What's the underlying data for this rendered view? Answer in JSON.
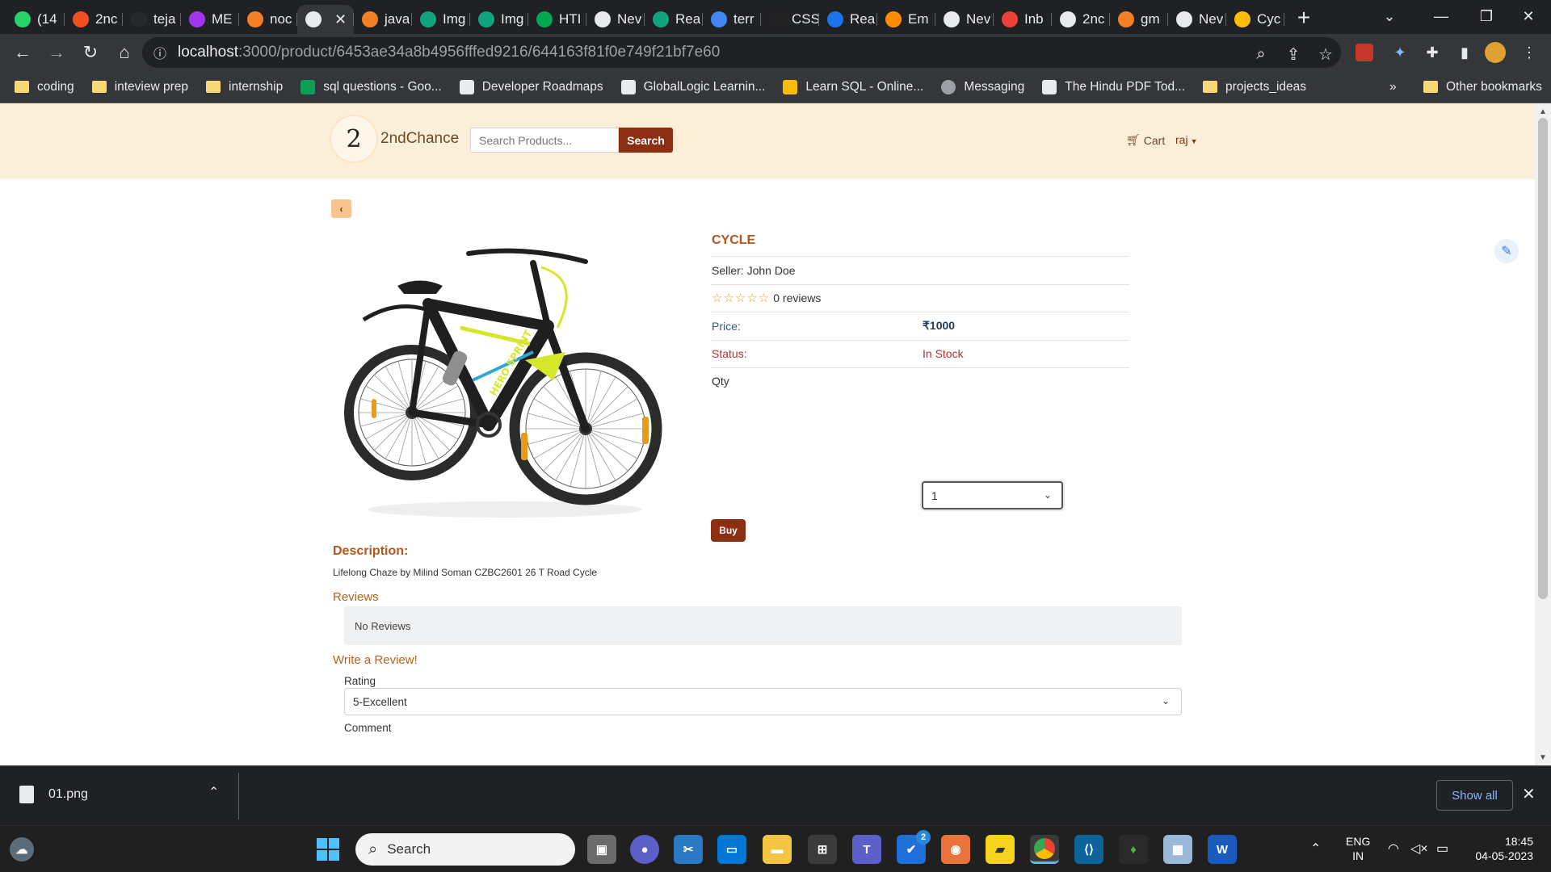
{
  "browser": {
    "tabs": [
      {
        "label": "(14",
        "color": "#25d366"
      },
      {
        "label": "2nc",
        "color": "#f24e1e"
      },
      {
        "label": "teja",
        "color": "#24292e"
      },
      {
        "label": "ME",
        "color": "#a435f0"
      },
      {
        "label": "noc",
        "color": "#f48024"
      },
      {
        "label": "",
        "color": "#e8eaed",
        "active": true
      },
      {
        "label": "java",
        "color": "#f48024"
      },
      {
        "label": "Img",
        "color": "#10a37f"
      },
      {
        "label": "Img",
        "color": "#10a37f"
      },
      {
        "label": "HTI",
        "color": "#00a651"
      },
      {
        "label": "Nev",
        "color": "#e8eaed"
      },
      {
        "label": "Rea",
        "color": "#10a37f"
      },
      {
        "label": "terr",
        "color": "#4285f4"
      },
      {
        "label": "CSS",
        "color": "#222222"
      },
      {
        "label": "Rea",
        "color": "#1a73e8"
      },
      {
        "label": "Em",
        "color": "#ff8c00"
      },
      {
        "label": "Nev",
        "color": "#e8eaed"
      },
      {
        "label": "Inb",
        "color": "#ea4335"
      },
      {
        "label": "2nc",
        "color": "#e8eaed"
      },
      {
        "label": "gm",
        "color": "#f48024"
      },
      {
        "label": "Nev",
        "color": "#e8eaed"
      },
      {
        "label": "Cyc",
        "color": "#fbbc04"
      }
    ],
    "url_host": "localhost",
    "url_path": ":3000/product/6453ae34a8b4956fffed9216/644163f81f0e749f21bf7e60",
    "bookmarks": [
      {
        "label": "coding",
        "type": "folder"
      },
      {
        "label": "inteview prep",
        "type": "folder"
      },
      {
        "label": "internship",
        "type": "folder"
      },
      {
        "label": "sql questions - Goo...",
        "type": "sheet"
      },
      {
        "label": "Developer Roadmaps",
        "type": "site"
      },
      {
        "label": "GlobalLogic Learnin...",
        "type": "site"
      },
      {
        "label": "Learn SQL - Online...",
        "type": "key"
      },
      {
        "label": "Messaging",
        "type": "globe"
      },
      {
        "label": "The Hindu PDF Tod...",
        "type": "site"
      },
      {
        "label": "projects_ideas",
        "type": "folder"
      }
    ],
    "bookmarks_more": "»",
    "other_bookmarks": "Other bookmarks"
  },
  "site": {
    "logo_text": "2",
    "brand": "2ndChance",
    "search_placeholder": "Search Products...",
    "search_button": "Search",
    "cart_label": "Cart",
    "user_label": "raj"
  },
  "product": {
    "back_symbol": "‹",
    "title": "CYCLE",
    "seller": "Seller: John Doe",
    "rating_stars": 0,
    "reviews_text": "0 reviews",
    "price_label": "Price:",
    "price_value": "₹1000",
    "status_label": "Status:",
    "status_value": "In Stock",
    "qty_label": "Qty",
    "qty_value": "1",
    "buy_label": "Buy",
    "description_heading": "Description:",
    "description_text": "Lifelong Chaze by Milind Soman CZBC2601 26 T Road Cycle",
    "reviews_heading": "Reviews",
    "no_reviews": "No Reviews",
    "write_review_heading": "Write a Review!",
    "rating_label": "Rating",
    "rating_value": "5-Excellent",
    "comment_label": "Comment",
    "image_text": "HERO SPRINT"
  },
  "download_shelf": {
    "file_name": "01.png",
    "show_all": "Show all"
  },
  "taskbar": {
    "search_label": "Search",
    "lang_line1": "ENG",
    "lang_line2": "IN",
    "time": "18:45",
    "date": "04-05-2023",
    "badge_count": "2"
  }
}
